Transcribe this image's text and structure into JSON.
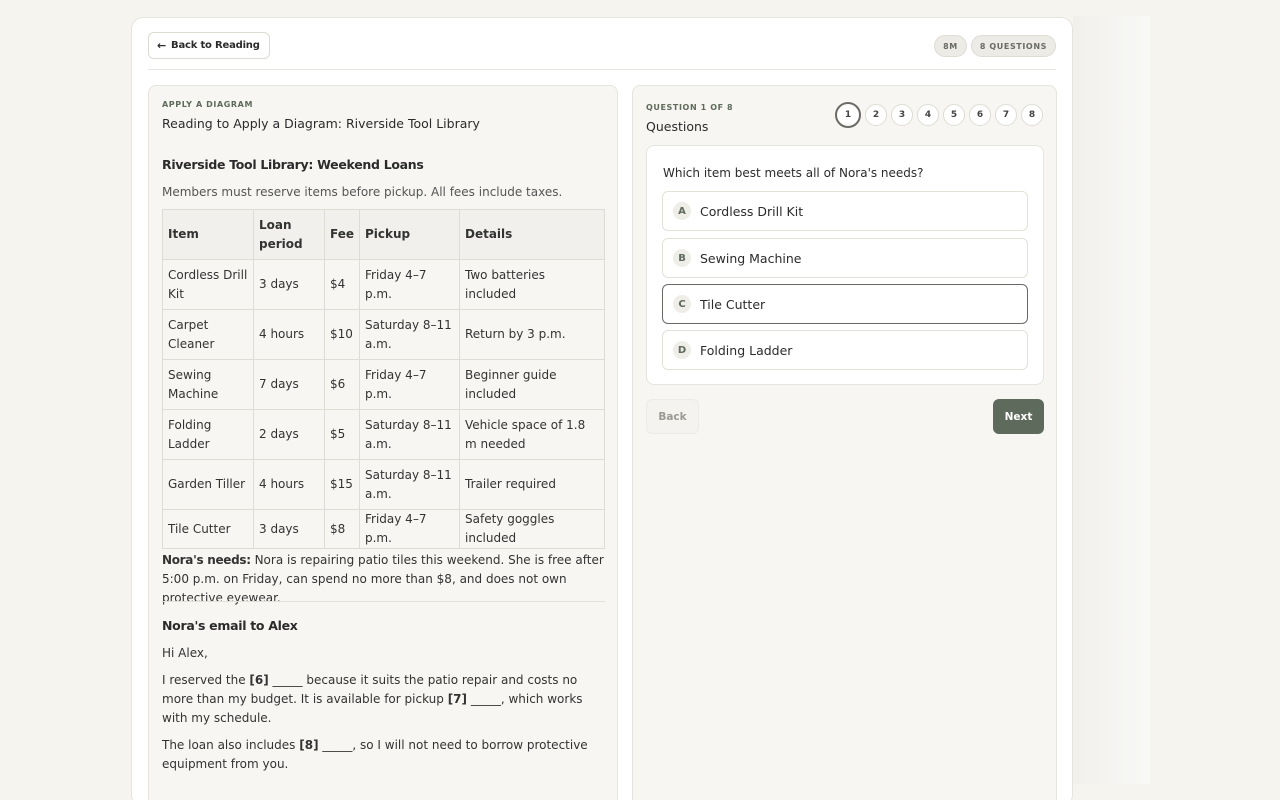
{
  "header": {
    "back_label": "Back to Reading",
    "time_pill": "8M",
    "questions_pill": "8 QUESTIONS"
  },
  "reading": {
    "eyebrow": "APPLY A DIAGRAM",
    "title": "Reading to Apply a Diagram: Riverside Tool Library",
    "doc_title": "Riverside Tool Library: Weekend Loans",
    "doc_subtitle": "Members must reserve items before pickup. All fees include taxes.",
    "table": {
      "headers": [
        "Item",
        "Loan period",
        "Fee",
        "Pickup",
        "Details"
      ],
      "rows": [
        [
          "Cordless Drill Kit",
          "3 days",
          "$4",
          "Friday 4–7 p.m.",
          "Two batteries included"
        ],
        [
          "Carpet Cleaner",
          "4 hours",
          "$10",
          "Saturday 8–11 a.m.",
          "Return by 3 p.m."
        ],
        [
          "Sewing Machine",
          "7 days",
          "$6",
          "Friday 4–7 p.m.",
          "Beginner guide included"
        ],
        [
          "Folding Ladder",
          "2 days",
          "$5",
          "Saturday 8–11 a.m.",
          "Vehicle space of 1.8 m needed"
        ],
        [
          "Garden Tiller",
          "4 hours",
          "$15",
          "Saturday 8–11 a.m.",
          "Trailer required"
        ],
        [
          "Tile Cutter",
          "3 days",
          "$8",
          "Friday 4–7 p.m.",
          "Safety goggles included"
        ]
      ]
    },
    "needs_label": "Nora's needs:",
    "needs_text": " Nora is repairing patio tiles this weekend. She is free after 5:00 p.m. on Friday, can spend no more than $8, and does not own protective eyewear.",
    "email_title": "Nora's email to Alex",
    "email_greeting": "Hi Alex,",
    "email_p1_a": "I reserved the ",
    "email_blank_6": "[6]",
    "email_p1_b": " _____ because it suits the patio repair and costs no more than my budget. It is available for pickup ",
    "email_blank_7": "[7]",
    "email_p1_c": " _____, which works with my schedule.",
    "email_p2_a": "The loan also includes ",
    "email_blank_8": "[8]",
    "email_p2_b": " _____, so I will not need to borrow protective equipment from you."
  },
  "questions": {
    "eyebrow": "QUESTION 1 OF 8",
    "title": "Questions",
    "nav": [
      "1",
      "2",
      "3",
      "4",
      "5",
      "6",
      "7",
      "8"
    ],
    "active_index": 0,
    "prompt": "Which item best meets all of Nora's needs?",
    "options": [
      {
        "letter": "A",
        "label": "Cordless Drill Kit"
      },
      {
        "letter": "B",
        "label": "Sewing Machine"
      },
      {
        "letter": "C",
        "label": "Tile Cutter"
      },
      {
        "letter": "D",
        "label": "Folding Ladder"
      }
    ],
    "selected": "C",
    "back_label": "Back",
    "next_label": "Next"
  }
}
